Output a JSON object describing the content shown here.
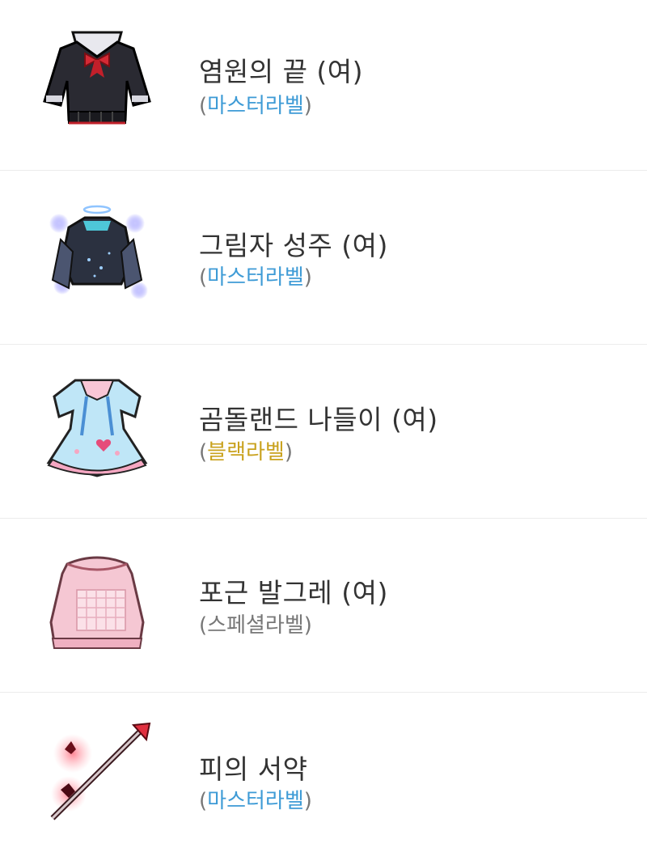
{
  "items": [
    {
      "name": "염원의 끝 (여)",
      "label_open": "(",
      "label": "마스터라벨",
      "label_close": ")",
      "label_color": "#3e9bd6",
      "icon": "black-sailor-uniform-icon"
    },
    {
      "name": "그림자 성주 (여)",
      "label_open": "(",
      "label": "마스터라벨",
      "label_close": ")",
      "label_color": "#3e9bd6",
      "icon": "shadow-lord-outfit-icon"
    },
    {
      "name": "곰돌랜드 나들이 (여)",
      "label_open": "(",
      "label": "블랙라벨",
      "label_close": ")",
      "label_color": "#c9a21e",
      "icon": "pastel-dress-icon"
    },
    {
      "name": "포근 발그레 (여)",
      "label_open": "(",
      "label": "스페셜라벨",
      "label_close": ")",
      "label_color": "#777777",
      "icon": "pink-knit-dress-icon"
    },
    {
      "name": "피의 서약",
      "label_open": "(",
      "label": "마스터라벨",
      "label_close": ")",
      "label_color": "#3e9bd6",
      "icon": "blood-oath-staff-icon"
    }
  ]
}
